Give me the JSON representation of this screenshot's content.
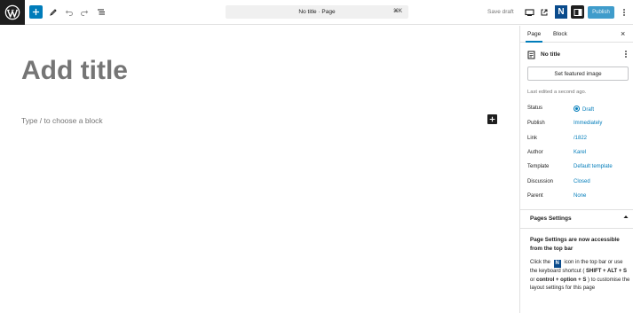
{
  "topbar": {
    "command_bar": "No title · Page",
    "command_shortcut": "⌘K",
    "save_draft": "Save draft",
    "n_label": "N",
    "publish": "Publish"
  },
  "editor": {
    "title_placeholder": "Add title",
    "block_placeholder": "Type / to choose a block"
  },
  "sidebar": {
    "tabs": [
      "Page",
      "Block"
    ],
    "close": "×",
    "page_name": "No title",
    "featured_image_button": "Set featured image",
    "last_edited": "Last edited a second ago.",
    "meta": [
      {
        "label": "Status",
        "value": "Draft"
      },
      {
        "label": "Publish",
        "value": "Immediately"
      },
      {
        "label": "Link",
        "value": "/1822"
      },
      {
        "label": "Author",
        "value": "Karel"
      },
      {
        "label": "Template",
        "value": "Default template"
      },
      {
        "label": "Discussion",
        "value": "Closed"
      },
      {
        "label": "Parent",
        "value": "None"
      }
    ],
    "panel": {
      "header": "Pages Settings",
      "notice_title": "Page Settings are now accessible from the top bar",
      "body_1": "Click the",
      "body_icon": "N",
      "body_2": "icon in the top bar or use the keyboard shortcut (",
      "shortcut_1": "SHIFT + ALT + S",
      "body_3": "or",
      "shortcut_2": "control + option + S",
      "body_4": ") to customise the layout settings for this page"
    }
  },
  "colors": {
    "accent": "#007cba",
    "dark": "#1e1e1e",
    "muted": "#757575",
    "n_badge": "#0a4b8c"
  }
}
